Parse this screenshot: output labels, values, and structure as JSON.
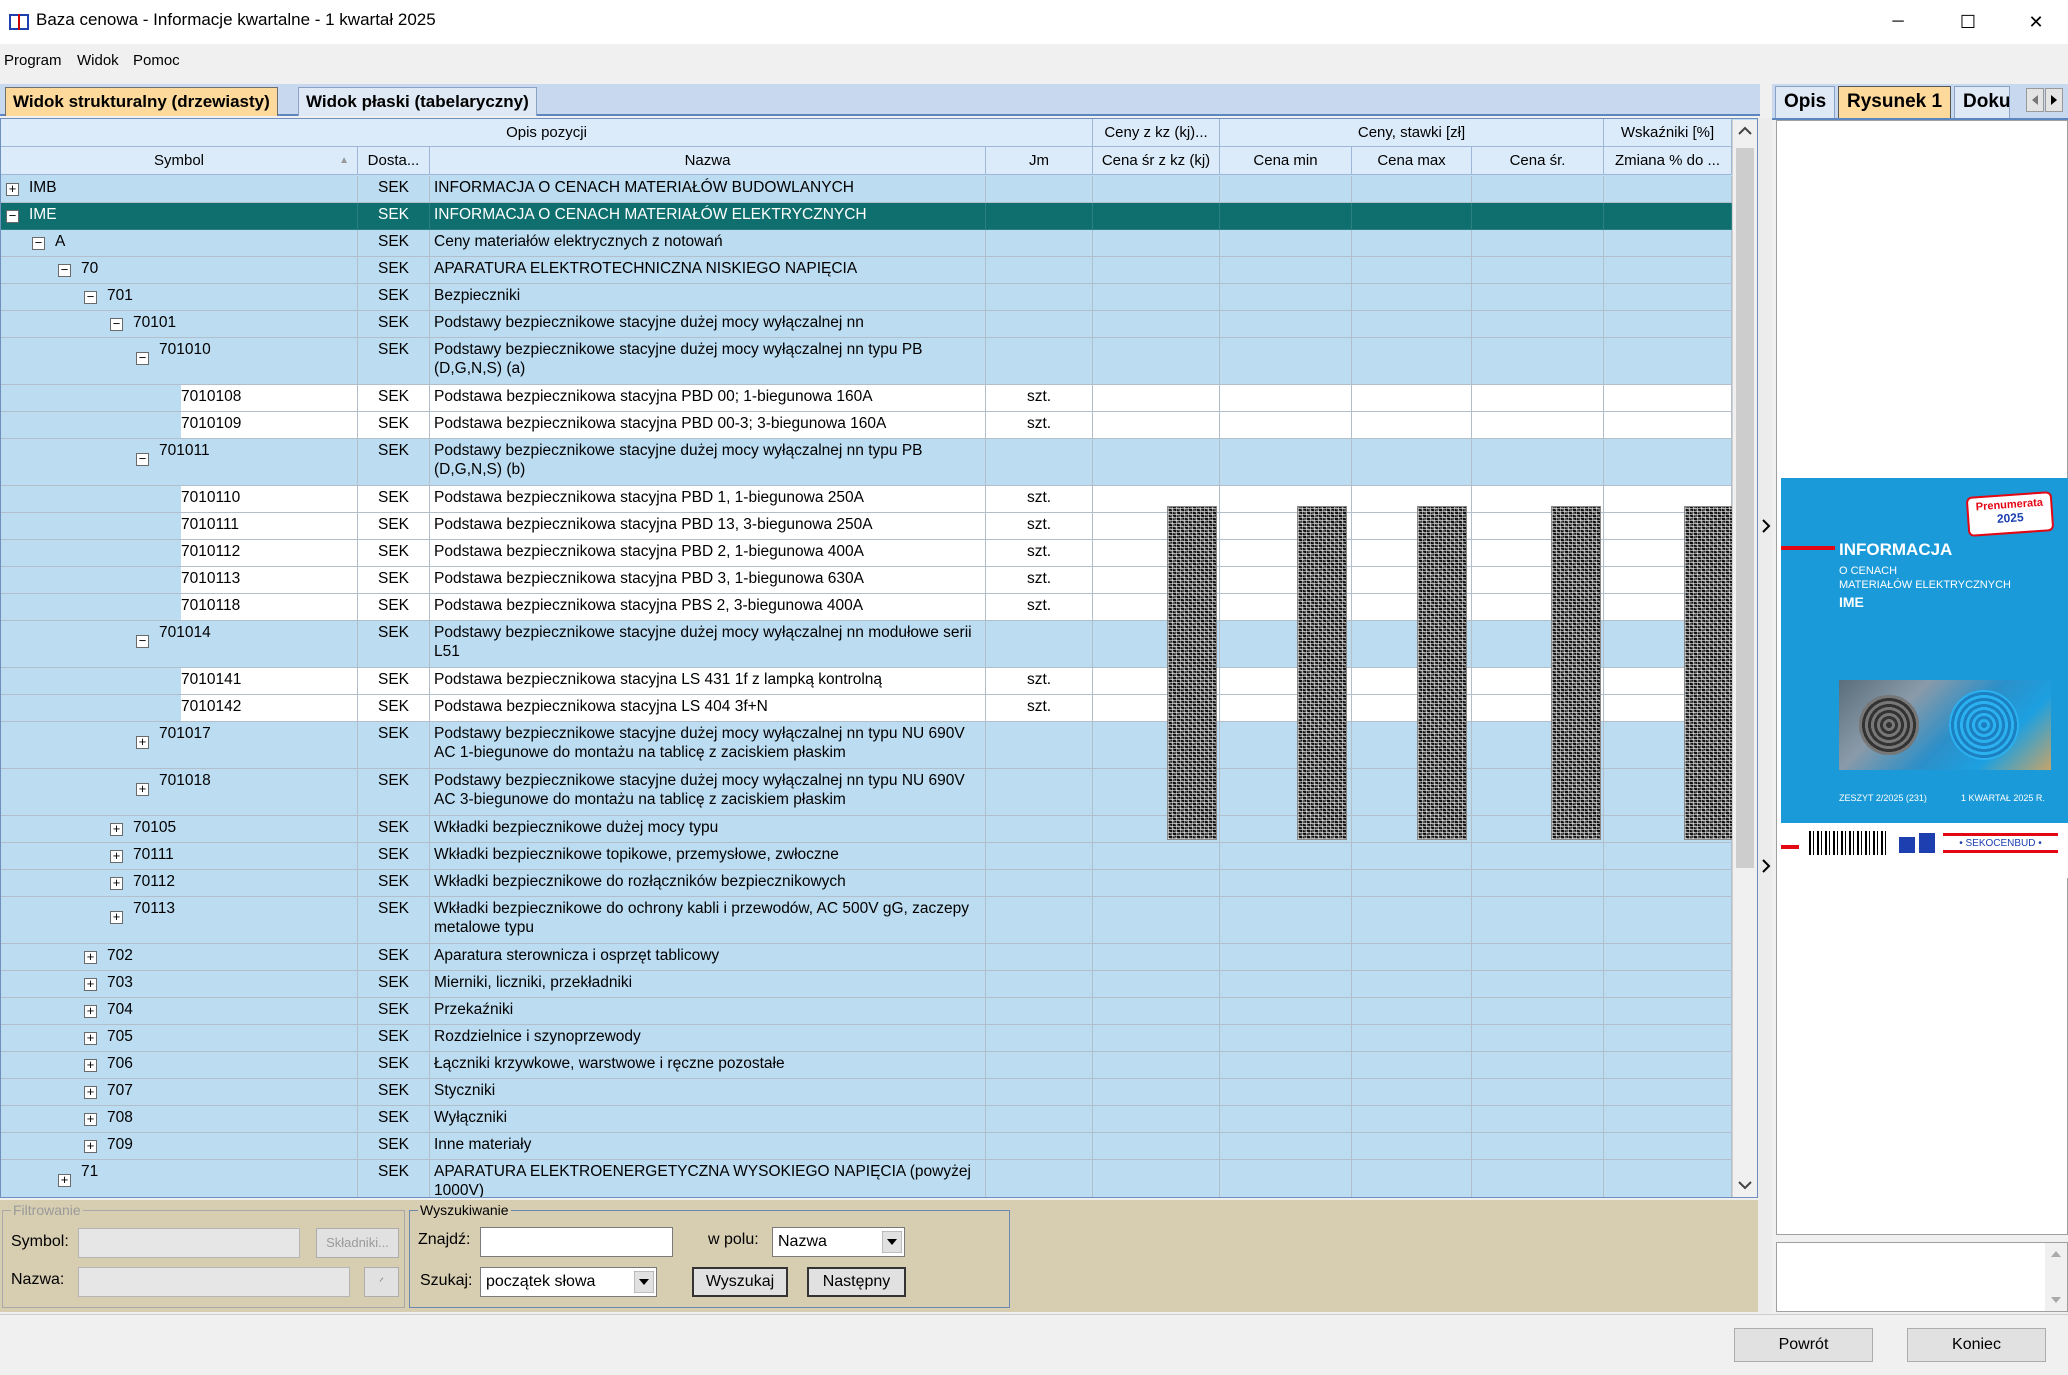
{
  "window": {
    "title": "Baza cenowa - Informacje kwartalne - 1 kwartał 2025",
    "controls": {
      "minimize": "─",
      "maximize": "☐",
      "close": "✕"
    }
  },
  "menu": [
    "Program",
    "Widok",
    "Pomoc"
  ],
  "tabs": {
    "structural": "Widok strukturalny (drzewiasty)",
    "flat": "Widok płaski (tabelaryczny)"
  },
  "grid": {
    "group_headers": {
      "opis": "Opis pozycji",
      "ceny_kz": "Ceny z kz (kj)...",
      "ceny": "Ceny, stawki [zł]",
      "wskazniki": "Wskaźniki [%]"
    },
    "columns": {
      "symbol": "Symbol",
      "dostawca": "Dosta...",
      "nazwa": "Nazwa",
      "jm": "Jm",
      "cena_kz": "Cena śr z kz (kj)",
      "cena_min": "Cena min",
      "cena_max": "Cena max",
      "cena_sr": "Cena śr.",
      "zmiana": "Zmiana % do ..."
    },
    "sort_indicator": "▲",
    "rows": [
      {
        "symbol": "IMB",
        "dost": "SEK",
        "nazwa": "INFORMACJA O CENACH MATERIAŁÓW BUDOWLANYCH",
        "jm": "",
        "level": 0,
        "exp": "+"
      },
      {
        "symbol": "IME",
        "dost": "SEK",
        "nazwa": "INFORMACJA O CENACH MATERIAŁÓW ELEKTRYCZNYCH",
        "jm": "",
        "level": 0,
        "exp": "−",
        "selected": true
      },
      {
        "symbol": "A",
        "dost": "SEK",
        "nazwa": "Ceny materiałów elektrycznych z notowań",
        "jm": "",
        "level": 1,
        "exp": "−"
      },
      {
        "symbol": "70",
        "dost": "SEK",
        "nazwa": "APARATURA ELEKTROTECHNICZNA NISKIEGO NAPIĘCIA",
        "jm": "",
        "level": 2,
        "exp": "−"
      },
      {
        "symbol": "701",
        "dost": "SEK",
        "nazwa": "Bezpieczniki",
        "jm": "",
        "level": 3,
        "exp": "−"
      },
      {
        "symbol": "70101",
        "dost": "SEK",
        "nazwa": "Podstawy bezpiecznikowe stacyjne dużej mocy wyłączalnej nn",
        "jm": "",
        "level": 4,
        "exp": "−"
      },
      {
        "symbol": "701010",
        "dost": "SEK",
        "nazwa": "Podstawy bezpiecznikowe stacyjne dużej mocy wyłączalnej nn typu PB (D,G,N,S) (a)",
        "jm": "",
        "level": 5,
        "exp": "−",
        "tall": true
      },
      {
        "symbol": "7010108",
        "dost": "SEK",
        "nazwa": "Podstawa bezpiecznikowa stacyjna PBD 00; 1-biegunowa 160A",
        "jm": "szt.",
        "level": 6,
        "leaf": true
      },
      {
        "symbol": "7010109",
        "dost": "SEK",
        "nazwa": "Podstawa bezpiecznikowa stacyjna PBD 00-3; 3-biegunowa 160A",
        "jm": "szt.",
        "level": 6,
        "leaf": true
      },
      {
        "symbol": "701011",
        "dost": "SEK",
        "nazwa": "Podstawy bezpiecznikowe stacyjne dużej mocy wyłączalnej nn typu PB (D,G,N,S) (b)",
        "jm": "",
        "level": 5,
        "exp": "−",
        "tall": true
      },
      {
        "symbol": "7010110",
        "dost": "SEK",
        "nazwa": "Podstawa bezpiecznikowa stacyjna PBD 1, 1-biegunowa 250A",
        "jm": "szt.",
        "level": 6,
        "leaf": true
      },
      {
        "symbol": "7010111",
        "dost": "SEK",
        "nazwa": "Podstawa bezpiecznikowa stacyjna PBD 13, 3-biegunowa 250A",
        "jm": "szt.",
        "level": 6,
        "leaf": true
      },
      {
        "symbol": "7010112",
        "dost": "SEK",
        "nazwa": "Podstawa bezpiecznikowa stacyjna PBD 2, 1-biegunowa 400A",
        "jm": "szt.",
        "level": 6,
        "leaf": true
      },
      {
        "symbol": "7010113",
        "dost": "SEK",
        "nazwa": "Podstawa bezpiecznikowa stacyjna PBD 3, 1-biegunowa 630A",
        "jm": "szt.",
        "level": 6,
        "leaf": true
      },
      {
        "symbol": "7010118",
        "dost": "SEK",
        "nazwa": "Podstawa bezpiecznikowa stacyjna PBS 2, 3-biegunowa 400A",
        "jm": "szt.",
        "level": 6,
        "leaf": true
      },
      {
        "symbol": "701014",
        "dost": "SEK",
        "nazwa": "Podstawy bezpiecznikowe stacyjne dużej mocy wyłączalnej nn modułowe serii L51",
        "jm": "",
        "level": 5,
        "exp": "−",
        "tall": true
      },
      {
        "symbol": "7010141",
        "dost": "SEK",
        "nazwa": "Podstawa bezpiecznikowa stacyjna LS 431 1f z lampką kontrolną",
        "jm": "szt.",
        "level": 6,
        "leaf": true
      },
      {
        "symbol": "7010142",
        "dost": "SEK",
        "nazwa": "Podstawa bezpiecznikowa stacyjna LS 404 3f+N",
        "jm": "szt.",
        "level": 6,
        "leaf": true
      },
      {
        "symbol": "701017",
        "dost": "SEK",
        "nazwa": "Podstawy bezpiecznikowe stacyjne dużej mocy wyłączalnej nn typu NU 690V AC 1-biegunowe do montażu na tablicę z zaciskiem płaskim",
        "jm": "",
        "level": 5,
        "exp": "+",
        "tall": true
      },
      {
        "symbol": "701018",
        "dost": "SEK",
        "nazwa": "Podstawy bezpiecznikowe stacyjne dużej mocy wyłączalnej nn typu NU 690V AC 3-biegunowe do montażu na tablicę z zaciskiem płaskim",
        "jm": "",
        "level": 5,
        "exp": "+",
        "tall": true
      },
      {
        "symbol": "70105",
        "dost": "SEK",
        "nazwa": "Wkładki bezpiecznikowe dużej mocy typu",
        "jm": "",
        "level": 4,
        "exp": "+"
      },
      {
        "symbol": "70111",
        "dost": "SEK",
        "nazwa": "Wkładki bezpiecznikowe topikowe, przemysłowe, zwłoczne",
        "jm": "",
        "level": 4,
        "exp": "+"
      },
      {
        "symbol": "70112",
        "dost": "SEK",
        "nazwa": "Wkładki bezpiecznikowe do rozłączników bezpiecznikowych",
        "jm": "",
        "level": 4,
        "exp": "+"
      },
      {
        "symbol": "70113",
        "dost": "SEK",
        "nazwa": "Wkładki bezpiecznikowe do ochrony kabli i przewodów, AC 500V gG, zaczepy metalowe typu",
        "jm": "",
        "level": 4,
        "exp": "+",
        "tall": true
      },
      {
        "symbol": "702",
        "dost": "SEK",
        "nazwa": "Aparatura sterownicza i osprzęt tablicowy",
        "jm": "",
        "level": 3,
        "exp": "+"
      },
      {
        "symbol": "703",
        "dost": "SEK",
        "nazwa": "Mierniki, liczniki, przekładniki",
        "jm": "",
        "level": 3,
        "exp": "+"
      },
      {
        "symbol": "704",
        "dost": "SEK",
        "nazwa": "Przekaźniki",
        "jm": "",
        "level": 3,
        "exp": "+"
      },
      {
        "symbol": "705",
        "dost": "SEK",
        "nazwa": "Rozdzielnice i szynoprzewody",
        "jm": "",
        "level": 3,
        "exp": "+"
      },
      {
        "symbol": "706",
        "dost": "SEK",
        "nazwa": "Łączniki krzywkowe, warstwowe i ręczne pozostałe",
        "jm": "",
        "level": 3,
        "exp": "+"
      },
      {
        "symbol": "707",
        "dost": "SEK",
        "nazwa": "Styczniki",
        "jm": "",
        "level": 3,
        "exp": "+"
      },
      {
        "symbol": "708",
        "dost": "SEK",
        "nazwa": "Wyłączniki",
        "jm": "",
        "level": 3,
        "exp": "+"
      },
      {
        "symbol": "709",
        "dost": "SEK",
        "nazwa": "Inne materiały",
        "jm": "",
        "level": 3,
        "exp": "+"
      },
      {
        "symbol": "71",
        "dost": "SEK",
        "nazwa": "APARATURA ELEKTROENERGETYCZNA WYSOKIEGO NAPIĘCIA (powyżej 1000V)",
        "jm": "",
        "level": 2,
        "exp": "+",
        "tall": true
      }
    ]
  },
  "filter": {
    "legend": "Filtrowanie",
    "symbol_label": "Symbol:",
    "nazwa_label": "Nazwa:",
    "skladniki_btn": "Składniki...",
    "clear_btn": "ᐟ"
  },
  "search": {
    "legend": "Wyszukiwanie",
    "find_label": "Znajdź:",
    "field_label": "w polu:",
    "field_value": "Nazwa",
    "mode_label": "Szukaj:",
    "mode_value": "początek słowa",
    "search_btn": "Wyszukaj",
    "next_btn": "Następny"
  },
  "right_tabs": {
    "opis": "Opis",
    "rysunek": "Rysunek 1",
    "dokument": "Doku"
  },
  "cover": {
    "badge_line1": "Prenumerata",
    "badge_line2": "2025",
    "title": "INFORMACJA",
    "line1": "O CENACH",
    "line2": "MATERIAŁÓW ELEKTRYCZNYCH",
    "code": "IME",
    "issue": "ZESZYT 2/2025 (231)",
    "quarter": "1 KWARTAŁ 2025 R.",
    "brand": "• SEKOCENBUD •"
  },
  "buttons": {
    "back": "Powrót",
    "end": "Koniec"
  },
  "colors": {
    "selected_row": "#0f6e6e",
    "active_tab": "#fdd99b",
    "grid_bg": "#bcdcf1",
    "cover_blue": "#1a9ad8",
    "cover_red": "#e30613"
  }
}
